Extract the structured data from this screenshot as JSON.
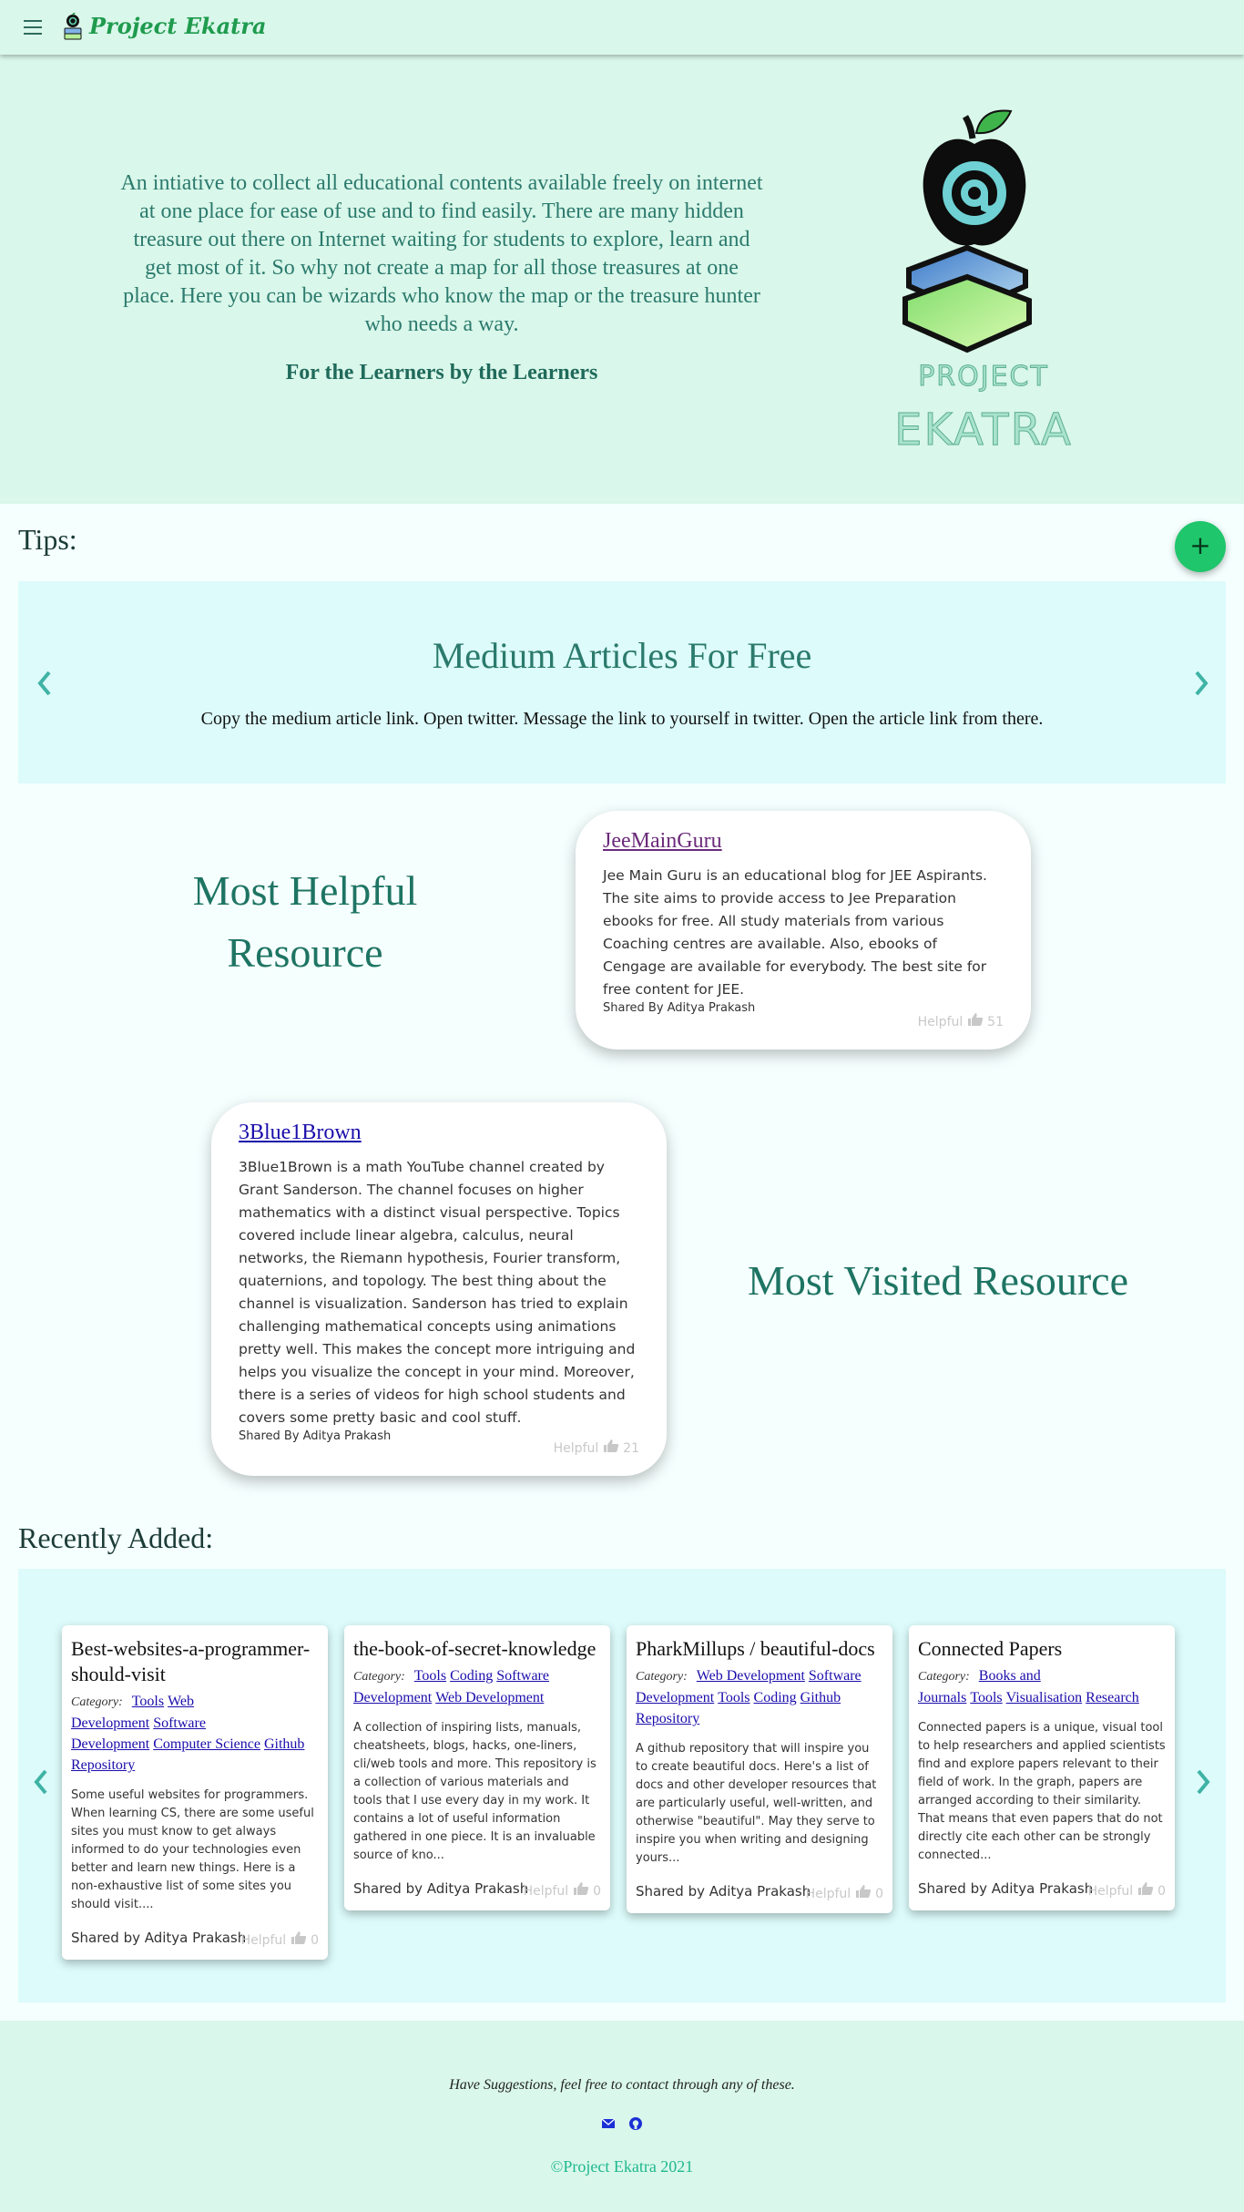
{
  "navbar": {
    "brand": "Project Ekatra"
  },
  "hero": {
    "description": "An intiative to collect all educational contents available freely on internet at one place for ease of use and to find easily. There are many hidden treasure out there on Internet waiting for students to explore, learn and get most of it. So why not create a map for all those treasures at one place. Here you can be wizards who know the map or the treasure hunter who needs a way.",
    "tagline": "For the Learners by the Learners",
    "logo_word1": "PROJECT",
    "logo_word2": "EKATRA"
  },
  "tips": {
    "heading": "Tips:",
    "add_label": "+",
    "title": "Medium Articles For Free",
    "body": "Copy the medium article link. Open twitter. Message the link to yourself in twitter. Open the article link from there."
  },
  "most_helpful": {
    "label_line1": "Most Helpful",
    "label_line2": "Resource",
    "title": "JeeMainGuru",
    "description": "Jee Main Guru is an educational blog for JEE Aspirants. The site aims to provide access to Jee Preparation ebooks for free. All study materials from various Coaching centres are available. Also, ebooks of Cengage are available for everybody. The best site for free content for JEE.",
    "shared_by": "Shared By Aditya Prakash",
    "helpful_label": "Helpful",
    "helpful_count": "51",
    "title_color": "#6b2a7a"
  },
  "most_visited": {
    "label": "Most Visited Resource",
    "title": "3Blue1Brown",
    "description": "3Blue1Brown is a math YouTube channel created by Grant Sanderson. The channel focuses on higher mathematics with a distinct visual perspective. Topics covered include linear algebra, calculus, neural networks, the Riemann hypothesis, Fourier transform, quaternions, and topology. The best thing about the channel is visualization. Sanderson has tried to explain challenging mathematical concepts using animations pretty well. This makes the concept more intriguing and helps you visualize the concept in your mind. Moreover, there is a series of videos for high school students and covers some pretty basic and cool stuff.",
    "shared_by": "Shared By Aditya Prakash",
    "helpful_label": "Helpful",
    "helpful_count": "21",
    "title_color": "#1a0dab"
  },
  "recent": {
    "heading": "Recently Added:",
    "category_label": "Category:",
    "cards": [
      {
        "title": "Best-websites-a-programmer-should-visit",
        "categories": [
          "Tools",
          "Web Development",
          "Software Development",
          "Computer Science",
          "Github Repository"
        ],
        "description": "Some useful websites for programmers. When learning CS, there are some useful sites you must know to get always informed to do your technologies even better and learn new things. Here is a non-exhaustive list of some sites you should visit....",
        "shared_by": "Shared by Aditya Prakash",
        "helpful_label": "Helpful",
        "helpful_count": "0"
      },
      {
        "title": "the-book-of-secret-knowledge",
        "categories": [
          "Tools",
          "Coding",
          "Software Development",
          "Web Development"
        ],
        "description": "A collection of inspiring lists, manuals, cheatsheets, blogs, hacks, one-liners, cli/web tools and more. This repository is a collection of various materials and tools that I use every day in my work. It contains a lot of useful information gathered in one piece. It is an invaluable source of kno...",
        "shared_by": "Shared by Aditya Prakash",
        "helpful_label": "Helpful",
        "helpful_count": "0"
      },
      {
        "title": "PharkMillups / beautiful-docs",
        "categories": [
          "Web Development",
          "Software Development",
          "Tools",
          "Coding",
          "Github Repository"
        ],
        "description": "A github repository that will inspire you to create beautiful docs. Here's a list of docs and other developer resources that are particularly useful, well-written, and otherwise \"beautiful\". May they serve to inspire you when writing and designing yours...",
        "shared_by": "Shared by Aditya Prakash",
        "helpful_label": "Helpful",
        "helpful_count": "0"
      },
      {
        "title": "Connected Papers",
        "categories": [
          "Books and Journals",
          "Tools",
          "Visualisation",
          "Research"
        ],
        "description": "Connected papers is a unique, visual tool to help researchers and applied scientists find and explore papers relevant to their field of work. In the graph, papers are arranged according to their similarity. That means that even papers that do not directly cite each other can be strongly connected...",
        "shared_by": "Shared by Aditya Prakash",
        "helpful_label": "Helpful",
        "helpful_count": "0"
      }
    ]
  },
  "footer": {
    "text": "Have Suggestions, feel free to contact through any of these.",
    "copyright": "©Project Ekatra 2021"
  },
  "icons": {
    "menu": "menu-icon",
    "add": "plus-icon",
    "prev": "chevron-left-icon",
    "next": "chevron-right-icon",
    "thumb": "thumbs-up-icon",
    "mail": "mail-icon",
    "github": "github-icon"
  },
  "colors": {
    "hero_bg": "#d9f7ea",
    "panel_bg": "#dcfbfa",
    "accent": "#1fc66b",
    "heading_teal": "#2b7a6d",
    "link": "#1a0dab"
  }
}
